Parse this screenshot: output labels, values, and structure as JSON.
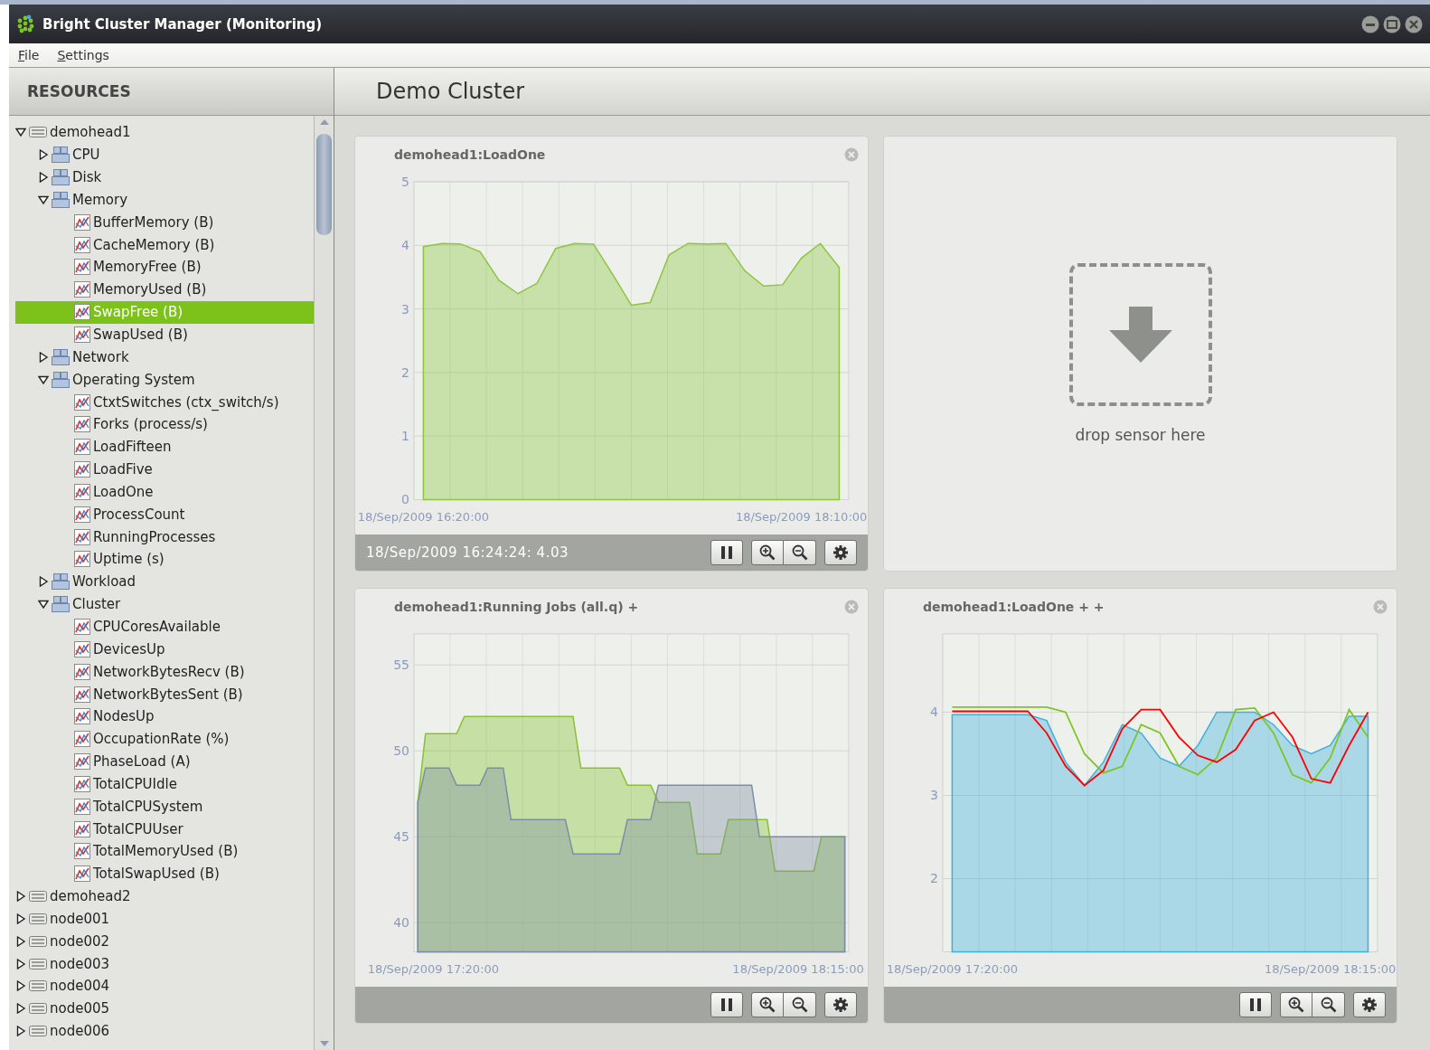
{
  "window": {
    "title": "Bright Cluster Manager (Monitoring)"
  },
  "menu": [
    {
      "label": "File"
    },
    {
      "label": "Settings"
    }
  ],
  "sidebar": {
    "title": "RESOURCES",
    "tree": [
      {
        "label": "demohead1",
        "kind": "node",
        "expanded": true,
        "selected": false,
        "children": [
          {
            "label": "CPU",
            "kind": "group",
            "expanded": false,
            "selected": false
          },
          {
            "label": "Disk",
            "kind": "group",
            "expanded": false,
            "selected": false
          },
          {
            "label": "Memory",
            "kind": "group",
            "expanded": true,
            "selected": false,
            "children": [
              {
                "label": "BufferMemory (B)",
                "kind": "sensor",
                "selected": false
              },
              {
                "label": "CacheMemory (B)",
                "kind": "sensor",
                "selected": false
              },
              {
                "label": "MemoryFree (B)",
                "kind": "sensor",
                "selected": false
              },
              {
                "label": "MemoryUsed (B)",
                "kind": "sensor",
                "selected": false
              },
              {
                "label": "SwapFree (B)",
                "kind": "sensor",
                "selected": true
              },
              {
                "label": "SwapUsed (B)",
                "kind": "sensor",
                "selected": false
              }
            ]
          },
          {
            "label": "Network",
            "kind": "group",
            "expanded": false,
            "selected": false
          },
          {
            "label": "Operating System",
            "kind": "group",
            "expanded": true,
            "selected": false,
            "children": [
              {
                "label": "CtxtSwitches (ctx_switch/s)",
                "kind": "sensor",
                "selected": false
              },
              {
                "label": "Forks (process/s)",
                "kind": "sensor",
                "selected": false
              },
              {
                "label": "LoadFifteen",
                "kind": "sensor",
                "selected": false
              },
              {
                "label": "LoadFive",
                "kind": "sensor",
                "selected": false
              },
              {
                "label": "LoadOne",
                "kind": "sensor",
                "selected": false
              },
              {
                "label": "ProcessCount",
                "kind": "sensor",
                "selected": false
              },
              {
                "label": "RunningProcesses",
                "kind": "sensor",
                "selected": false
              },
              {
                "label": "Uptime (s)",
                "kind": "sensor",
                "selected": false
              }
            ]
          },
          {
            "label": "Workload",
            "kind": "group",
            "expanded": false,
            "selected": false
          },
          {
            "label": "Cluster",
            "kind": "group",
            "expanded": true,
            "selected": false,
            "children": [
              {
                "label": "CPUCoresAvailable",
                "kind": "sensor",
                "selected": false
              },
              {
                "label": "DevicesUp",
                "kind": "sensor",
                "selected": false
              },
              {
                "label": "NetworkBytesRecv (B)",
                "kind": "sensor",
                "selected": false
              },
              {
                "label": "NetworkBytesSent (B)",
                "kind": "sensor",
                "selected": false
              },
              {
                "label": "NodesUp",
                "kind": "sensor",
                "selected": false
              },
              {
                "label": "OccupationRate (%)",
                "kind": "sensor",
                "selected": false
              },
              {
                "label": "PhaseLoad (A)",
                "kind": "sensor",
                "selected": false
              },
              {
                "label": "TotalCPUIdle",
                "kind": "sensor",
                "selected": false
              },
              {
                "label": "TotalCPUSystem",
                "kind": "sensor",
                "selected": false
              },
              {
                "label": "TotalCPUUser",
                "kind": "sensor",
                "selected": false
              },
              {
                "label": "TotalMemoryUsed (B)",
                "kind": "sensor",
                "selected": false
              },
              {
                "label": "TotalSwapUsed (B)",
                "kind": "sensor",
                "selected": false
              }
            ]
          }
        ]
      },
      {
        "label": "demohead2",
        "kind": "node",
        "expanded": false,
        "selected": false
      },
      {
        "label": "node001",
        "kind": "node",
        "expanded": false,
        "selected": false
      },
      {
        "label": "node002",
        "kind": "node",
        "expanded": false,
        "selected": false
      },
      {
        "label": "node003",
        "kind": "node",
        "expanded": false,
        "selected": false
      },
      {
        "label": "node004",
        "kind": "node",
        "expanded": false,
        "selected": false
      },
      {
        "label": "node005",
        "kind": "node",
        "expanded": false,
        "selected": false
      },
      {
        "label": "node006",
        "kind": "node",
        "expanded": false,
        "selected": false
      }
    ]
  },
  "main": {
    "title": "Demo Cluster",
    "cards": [
      {
        "kind": "chart",
        "title": "demohead1:LoadOne",
        "readout": "18/Sep/2009 16:24:24: 4.03",
        "chart_data": {
          "type": "area",
          "categories": [
            "18/Sep/2009 16:20:00",
            null,
            null,
            null,
            null,
            null,
            null,
            null,
            null,
            null,
            null,
            null,
            null,
            null,
            null,
            null,
            null,
            null,
            null,
            null,
            "18/Sep/2009 18:10:00",
            null,
            null
          ],
          "ylim": [
            0,
            5
          ],
          "yticks": [
            0,
            1,
            2,
            3,
            4,
            5
          ],
          "grid": true,
          "series": [
            {
              "color": "#8cc63f",
              "values": [
                3.98,
                4.03,
                4.02,
                3.9,
                3.45,
                3.24,
                3.4,
                3.95,
                4.03,
                4.02,
                3.55,
                3.06,
                3.1,
                3.85,
                4.03,
                4.02,
                4.03,
                3.6,
                3.36,
                3.38,
                3.8,
                4.03,
                3.65
              ]
            }
          ]
        }
      },
      {
        "kind": "drop",
        "label": "drop sensor here"
      },
      {
        "kind": "chart",
        "title": "demohead1:Running Jobs (all.q) +",
        "chart_data": {
          "type": "area",
          "categories": [
            null,
            null,
            "18/Sep/2009 17:20:00",
            null,
            null,
            null,
            null,
            null,
            null,
            null,
            null,
            null,
            null,
            null,
            null,
            null,
            null,
            null,
            null,
            null,
            null,
            null,
            null,
            null,
            null,
            null,
            null,
            null,
            null,
            null,
            null,
            null,
            null,
            null,
            null,
            null,
            null,
            null,
            null,
            null,
            null,
            null,
            null,
            null,
            null,
            null,
            null,
            null,
            null,
            "18/Sep/2009 18:15:00",
            null,
            null,
            null,
            null,
            null,
            null
          ],
          "ylim": [
            38.3,
            56.8
          ],
          "yticks": [
            40,
            45,
            50,
            55
          ],
          "grid": true,
          "series": [
            {
              "color": "#86c232",
              "values": [
                47,
                51,
                51,
                51,
                51,
                51,
                52,
                52,
                52,
                52,
                52,
                52,
                52,
                52,
                52,
                52,
                52,
                52,
                52,
                52,
                52,
                49,
                49,
                49,
                49,
                49,
                49,
                48,
                48,
                48,
                48,
                47,
                47,
                47,
                47,
                47,
                44,
                44,
                44,
                44,
                46,
                46,
                46,
                46,
                46,
                46,
                43,
                43,
                43,
                43,
                43,
                43,
                45,
                45,
                45,
                45
              ]
            },
            {
              "color": "#7f8ea6",
              "values": [
                47,
                49,
                49,
                49,
                49,
                48,
                48,
                48,
                48,
                49,
                49,
                49,
                46,
                46,
                46,
                46,
                46,
                46,
                46,
                46,
                44,
                44,
                44,
                44,
                44,
                44,
                44,
                46,
                46,
                46,
                46,
                48,
                48,
                48,
                48,
                48,
                48,
                48,
                48,
                48,
                48,
                48,
                48,
                48,
                45,
                45,
                45,
                45,
                45,
                45,
                45,
                45,
                45,
                45,
                45,
                45
              ]
            }
          ]
        }
      },
      {
        "kind": "chart",
        "title": "demohead1:LoadOne + +",
        "chart_data": {
          "type": "line",
          "categories": [
            "18/Sep/2009 17:20:00",
            null,
            null,
            null,
            null,
            null,
            null,
            null,
            null,
            null,
            null,
            null,
            null,
            null,
            null,
            null,
            null,
            null,
            null,
            null,
            "18/Sep/2009 18:15:00",
            null,
            null
          ],
          "ylim": [
            1.12,
            4.94
          ],
          "yticks": [
            2,
            3,
            4
          ],
          "grid": true,
          "series": [
            {
              "color": "#3fb0de",
              "type": "area",
              "values": [
                3.97,
                3.97,
                3.97,
                3.97,
                3.97,
                3.9,
                3.4,
                3.12,
                3.4,
                3.85,
                3.75,
                3.45,
                3.35,
                3.6,
                4.0,
                4.0,
                4.0,
                3.85,
                3.6,
                3.5,
                3.6,
                3.95,
                3.95
              ]
            },
            {
              "color": "#7cc623",
              "values": [
                4.06,
                4.06,
                4.06,
                4.06,
                4.06,
                4.06,
                4.0,
                3.5,
                3.27,
                3.35,
                3.85,
                3.75,
                3.35,
                3.25,
                3.45,
                4.03,
                4.05,
                3.75,
                3.25,
                3.15,
                3.45,
                4.03,
                3.7
              ]
            },
            {
              "color": "#ff0000",
              "values": [
                4.01,
                4.01,
                4.01,
                4.01,
                4.01,
                3.75,
                3.35,
                3.12,
                3.3,
                3.8,
                4.03,
                4.03,
                3.7,
                3.48,
                3.4,
                3.55,
                3.9,
                4.0,
                3.7,
                3.2,
                3.15,
                3.6,
                4.0
              ]
            }
          ]
        }
      }
    ]
  }
}
